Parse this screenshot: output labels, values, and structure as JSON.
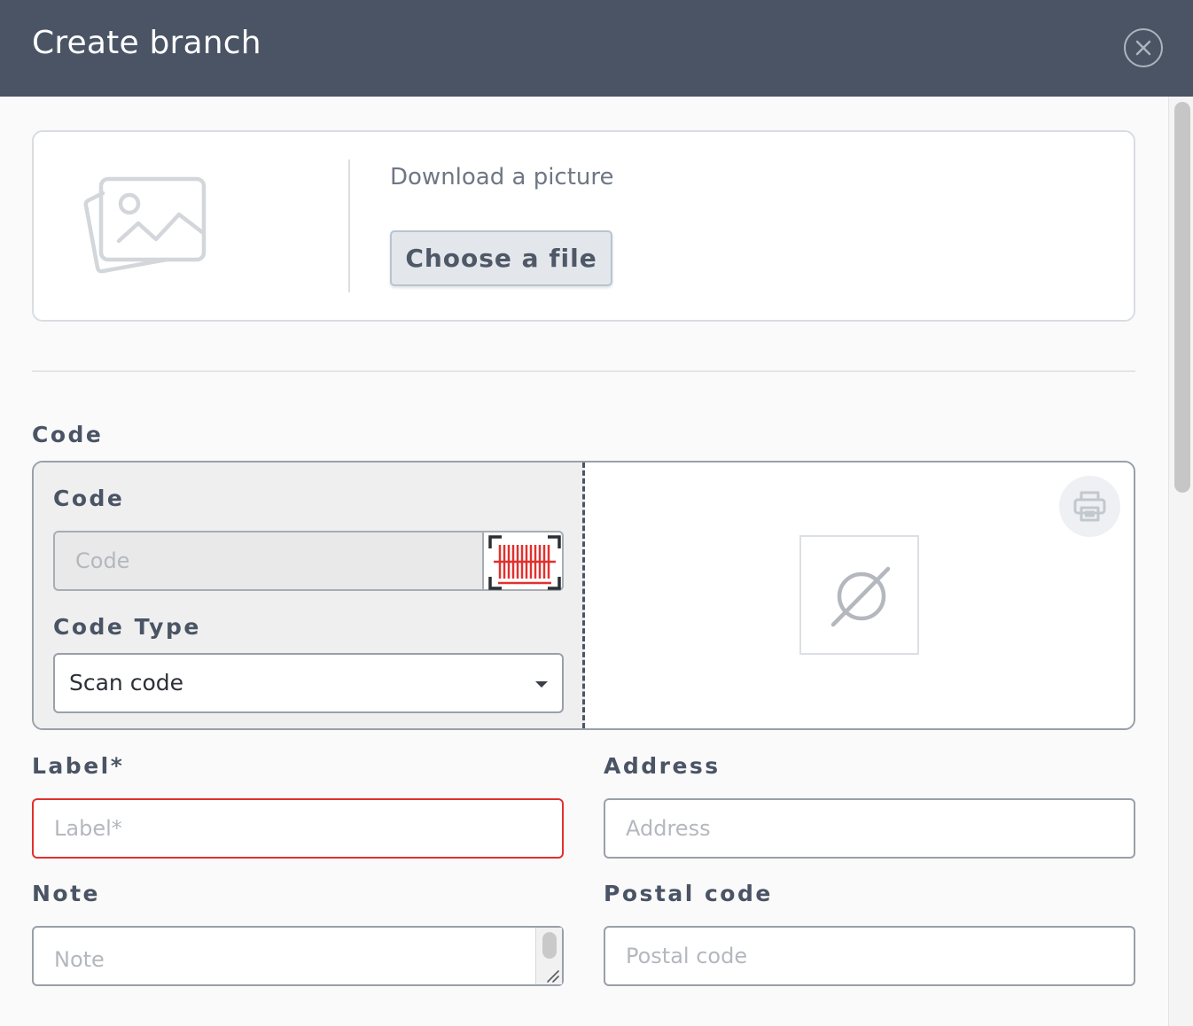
{
  "dialog": {
    "title": "Create branch",
    "close_icon": "close-circle-icon"
  },
  "picture": {
    "placeholder_icon": "image-placeholder-icon",
    "hint": "Download a picture",
    "choose_label": "Choose a file"
  },
  "code_section": {
    "heading": "Code",
    "code_label": "Code",
    "code_placeholder": "Code",
    "code_value": "",
    "scan_icon": "barcode-scan-icon",
    "scan_icon_color": "#e0312f",
    "code_type_label": "Code Type",
    "code_type_value": "Scan code",
    "print_icon": "printer-icon",
    "preview_icon": "empty-set-icon"
  },
  "fields": {
    "label": {
      "label": "Label*",
      "placeholder": "Label*",
      "value": "",
      "state": "error",
      "error_color": "#e0312f"
    },
    "address": {
      "label": "Address",
      "placeholder": "Address",
      "value": ""
    },
    "note": {
      "label": "Note",
      "placeholder": "Note",
      "value": ""
    },
    "postal_code": {
      "label": "Postal code",
      "placeholder": "Postal code",
      "value": ""
    }
  },
  "colors": {
    "header_bg": "#4a5465",
    "accent_text": "#4a5465"
  }
}
